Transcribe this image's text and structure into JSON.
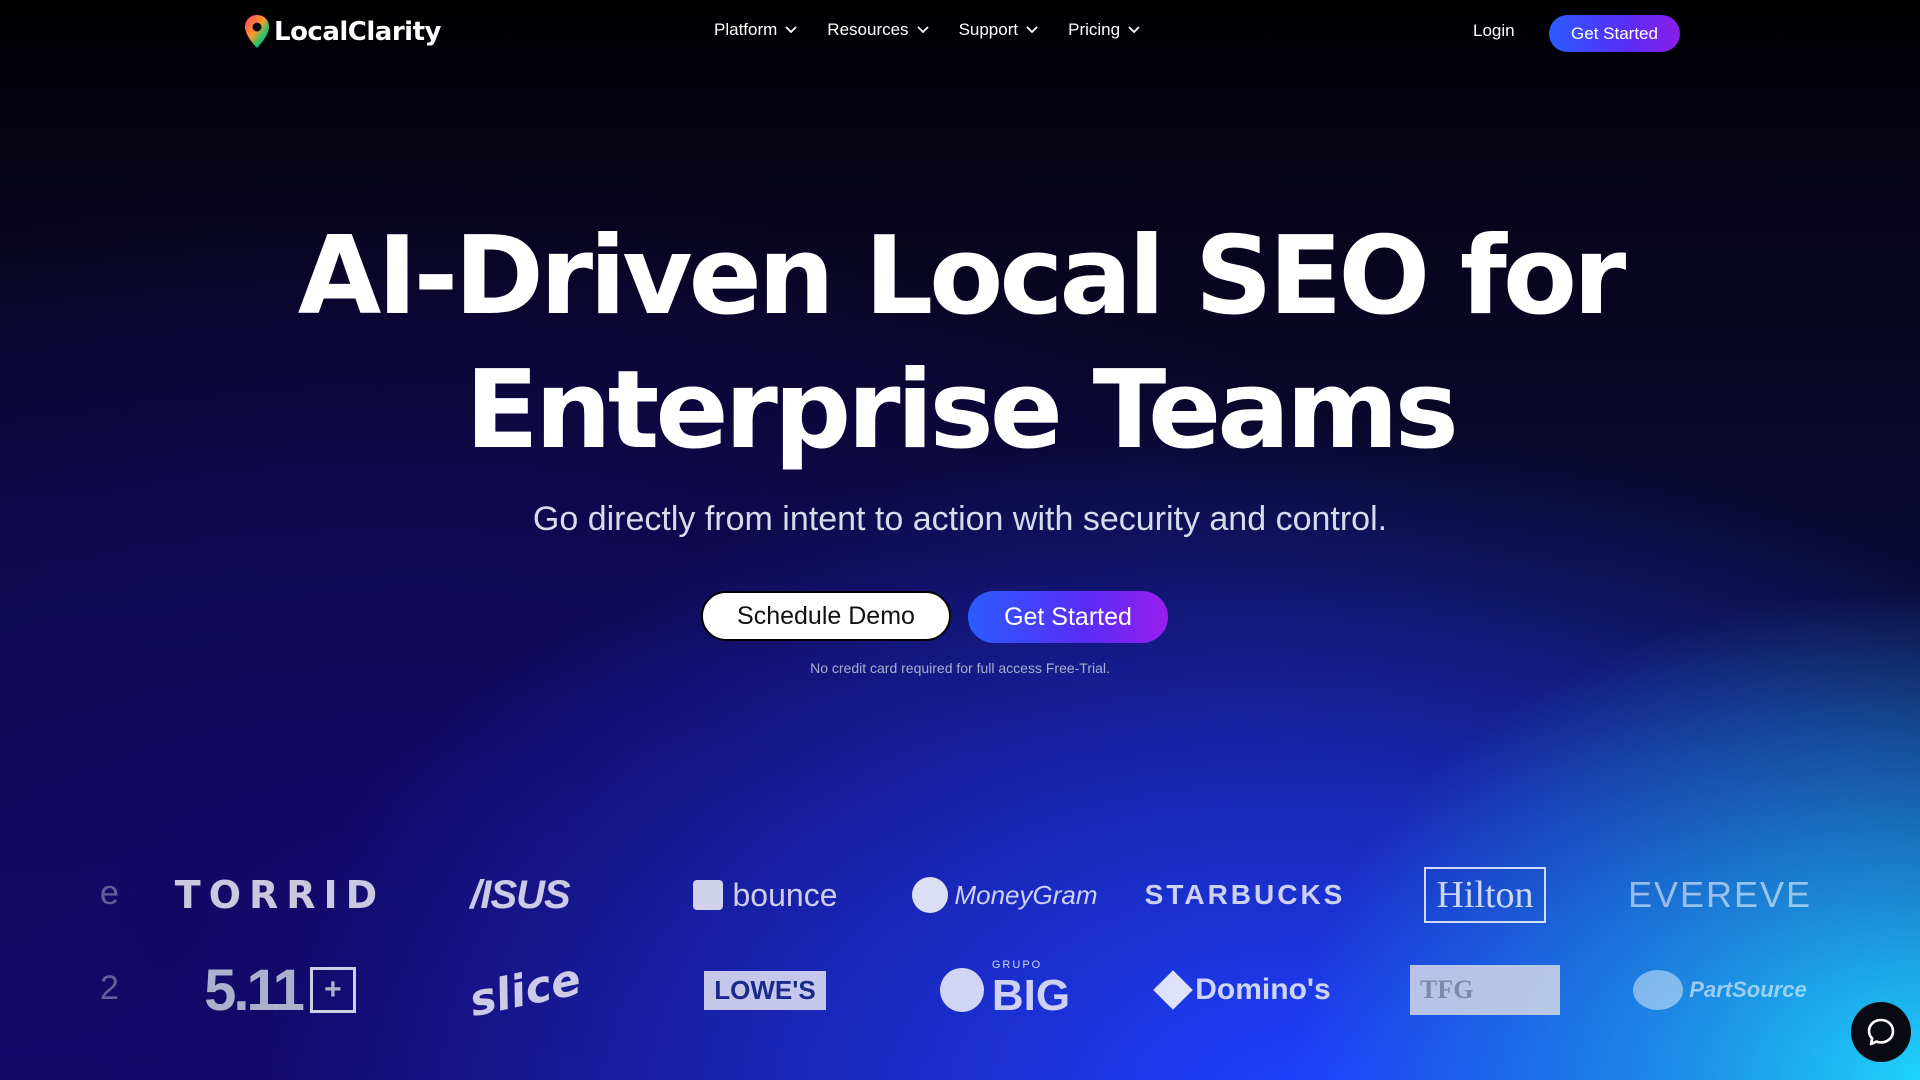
{
  "nav": {
    "brand": "LocalClarity",
    "menu": [
      {
        "label": "Platform"
      },
      {
        "label": "Resources"
      },
      {
        "label": "Support"
      },
      {
        "label": "Pricing"
      }
    ],
    "login_label": "Login",
    "cta_label": "Get Started"
  },
  "hero": {
    "title_line1": "AI-Driven Local SEO for",
    "title_line2": "Enterprise Teams",
    "subtitle": "Go directly from intent to action with security and control.",
    "demo_label": "Schedule Demo",
    "start_label": "Get Started",
    "note": "No credit card required for full access Free-Trial."
  },
  "logos": {
    "row1": [
      "TORRID",
      "/ISUS",
      "bounce",
      "MoneyGram",
      "STARBUCKS",
      "Hilton",
      "EVEREVE"
    ],
    "row2": [
      "5.11",
      "slice",
      "LOWE'S",
      "BIG",
      "Domino's",
      "TFG",
      "PartSource"
    ],
    "big_small": "GRUPO"
  },
  "colors": {
    "accent_start": "#2a5cff",
    "accent_end": "#8a1ee8",
    "background_dark": "#000000",
    "background_glow": "#1ed4ff"
  },
  "icons": {
    "brand_logo": "map-pin-icon",
    "menu_chevron": "chevron-down-icon",
    "chat": "chat-bubble-icon"
  }
}
